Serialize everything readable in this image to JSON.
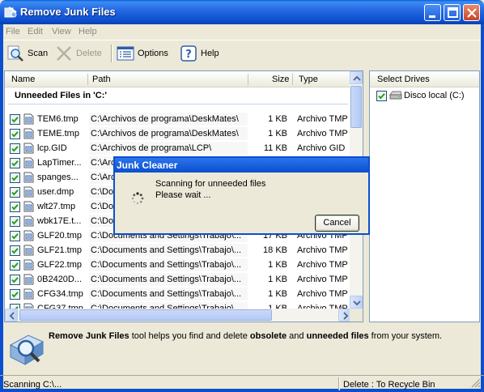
{
  "window": {
    "title": "Remove Junk Files"
  },
  "menu": [
    "File",
    "Edit",
    "View",
    "Help"
  ],
  "toolbar": {
    "scan": "Scan",
    "delete": "Delete",
    "options": "Options",
    "help": "Help"
  },
  "file_list": {
    "columns": {
      "name": "Name",
      "path": "Path",
      "size": "Size",
      "type": "Type"
    },
    "group_header": "Unneeded Files in 'C:'",
    "rows": [
      {
        "name": "TEM6.tmp",
        "path": "C:\\Archivos de programa\\DeskMates\\",
        "size": "1 KB",
        "type": "Archivo TMP"
      },
      {
        "name": "TEME.tmp",
        "path": "C:\\Archivos de programa\\DeskMates\\",
        "size": "1 KB",
        "type": "Archivo TMP"
      },
      {
        "name": "lcp.GID",
        "path": "C:\\Archivos de programa\\LCP\\",
        "size": "11 KB",
        "type": "Archivo GID"
      },
      {
        "name": "LapTimer...",
        "path": "C:\\Arc",
        "size": "",
        "type": ""
      },
      {
        "name": "spanges...",
        "path": "C:\\Arc",
        "size": "",
        "type": ""
      },
      {
        "name": "user.dmp",
        "path": "C:\\Do",
        "size": "",
        "type": ""
      },
      {
        "name": "wlt27.tmp",
        "path": "C:\\Do",
        "size": "",
        "type": ""
      },
      {
        "name": "wbk17E.t...",
        "path": "C:\\Do",
        "size": "",
        "type": ""
      },
      {
        "name": "GLF20.tmp",
        "path": "C:\\Documents and Settings\\Trabajo\\...",
        "size": "17 KB",
        "type": "Archivo TMP"
      },
      {
        "name": "GLF21.tmp",
        "path": "C:\\Documents and Settings\\Trabajo\\...",
        "size": "18 KB",
        "type": "Archivo TMP"
      },
      {
        "name": "GLF22.tmp",
        "path": "C:\\Documents and Settings\\Trabajo\\...",
        "size": "1 KB",
        "type": "Archivo TMP"
      },
      {
        "name": "0B2420D...",
        "path": "C:\\Documents and Settings\\Trabajo\\...",
        "size": "1 KB",
        "type": "Archivo TMP"
      },
      {
        "name": "CFG34.tmp",
        "path": "C:\\Documents and Settings\\Trabajo\\...",
        "size": "1 KB",
        "type": "Archivo TMP"
      },
      {
        "name": "CFG37.tmp",
        "path": "C:\\Documents and Settings\\Trabajo\\...",
        "size": "1 KB",
        "type": "Archivo TMP"
      }
    ]
  },
  "drives": {
    "header": "Select Drives",
    "items": [
      "Disco local (C:)"
    ]
  },
  "info": {
    "parts": [
      {
        "text": "Remove Junk Files",
        "bold": true
      },
      {
        "text": " tool helps you find and delete ",
        "bold": false
      },
      {
        "text": "obsolete",
        "bold": true
      },
      {
        "text": " and ",
        "bold": false
      },
      {
        "text": "unneeded files",
        "bold": true
      },
      {
        "text": " from your system.",
        "bold": false
      }
    ]
  },
  "status": {
    "left": "Scanning C:\\...",
    "right": "Delete : To Recycle Bin"
  },
  "dialog": {
    "title": "Junk Cleaner",
    "line1": "Scanning for unneeded files",
    "line2": "Please wait ...",
    "cancel": "Cancel"
  }
}
